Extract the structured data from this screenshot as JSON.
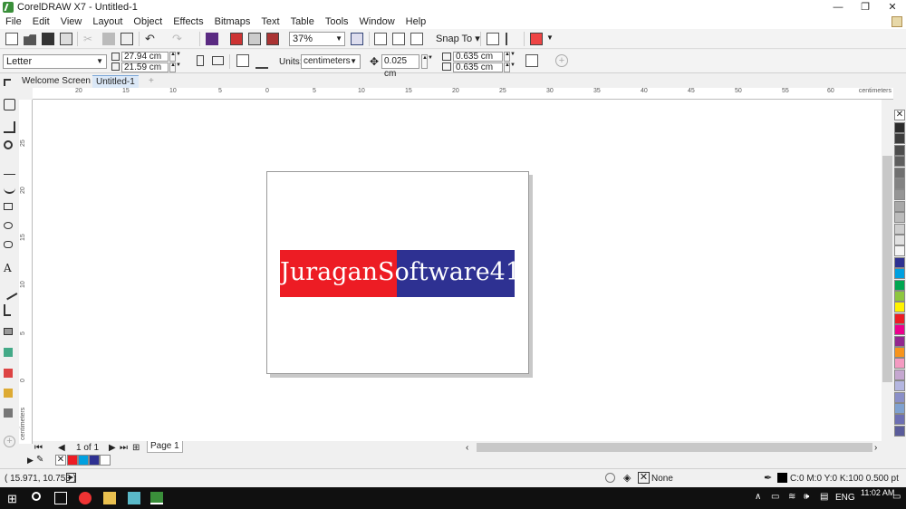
{
  "window": {
    "title": "CorelDRAW X7 - Untitled-1",
    "controls": [
      "—",
      "❐",
      "✕"
    ]
  },
  "menu": [
    "File",
    "Edit",
    "View",
    "Layout",
    "Object",
    "Effects",
    "Bitmaps",
    "Text",
    "Table",
    "Tools",
    "Window",
    "Help"
  ],
  "toolbar": {
    "zoom": "37%",
    "snap_label": "Snap To"
  },
  "property_bar": {
    "paper": "Letter",
    "width": "27.94 cm",
    "height": "21.59 cm",
    "units_label": "Units:",
    "units": "centimeters",
    "nudge": "0.025 cm",
    "dup_x": "0.635 cm",
    "dup_y": "0.635 cm"
  },
  "tabs": {
    "welcome": "Welcome Screen",
    "document": "Untitled-1"
  },
  "ruler": {
    "unit": "centimeters",
    "h_labels": [
      "20",
      "15",
      "10",
      "5",
      "0",
      "5",
      "10",
      "15",
      "20",
      "25",
      "30",
      "35",
      "40",
      "45",
      "50",
      "55",
      "60"
    ],
    "v_labels": [
      "25",
      "20",
      "15",
      "10",
      "5",
      "0",
      "centimeters"
    ]
  },
  "canvas": {
    "logo_text": "JuraganSoftware41",
    "colors": {
      "red": "#ed1c24",
      "blue": "#2e3192"
    }
  },
  "page_nav": {
    "counter": "1 of 1",
    "page_tab": "Page 1"
  },
  "palette": [
    "#2b2b2b",
    "#3c3c3c",
    "#4d4d4d",
    "#5e5e5e",
    "#707070",
    "#828282",
    "#959595",
    "#a8a8a8",
    "#bbbbbb",
    "#cecece",
    "#e1e1e1",
    "#f5f5f5",
    "#2e3192",
    "#00a0e0",
    "#00a651",
    "#8dc63f",
    "#fff200",
    "#ed1c24",
    "#ec008c",
    "#92278f",
    "#f7941d",
    "#f49ac1",
    "#c5a7d0",
    "#b4b6e0",
    "#8a8fc8",
    "#7fa1d0",
    "#6d6fb3",
    "#5a5c9a"
  ],
  "document_palette": [
    "#ed1c24",
    "#00a0e0",
    "#2e3192",
    "#ffffff"
  ],
  "status": {
    "coords": "( 15.971, 10.753 )",
    "fill": "None",
    "outline": "C:0 M:0 Y:0 K:100  0.500 pt"
  },
  "taskbar": {
    "lang": "ENG",
    "time": "11:02 AM"
  }
}
